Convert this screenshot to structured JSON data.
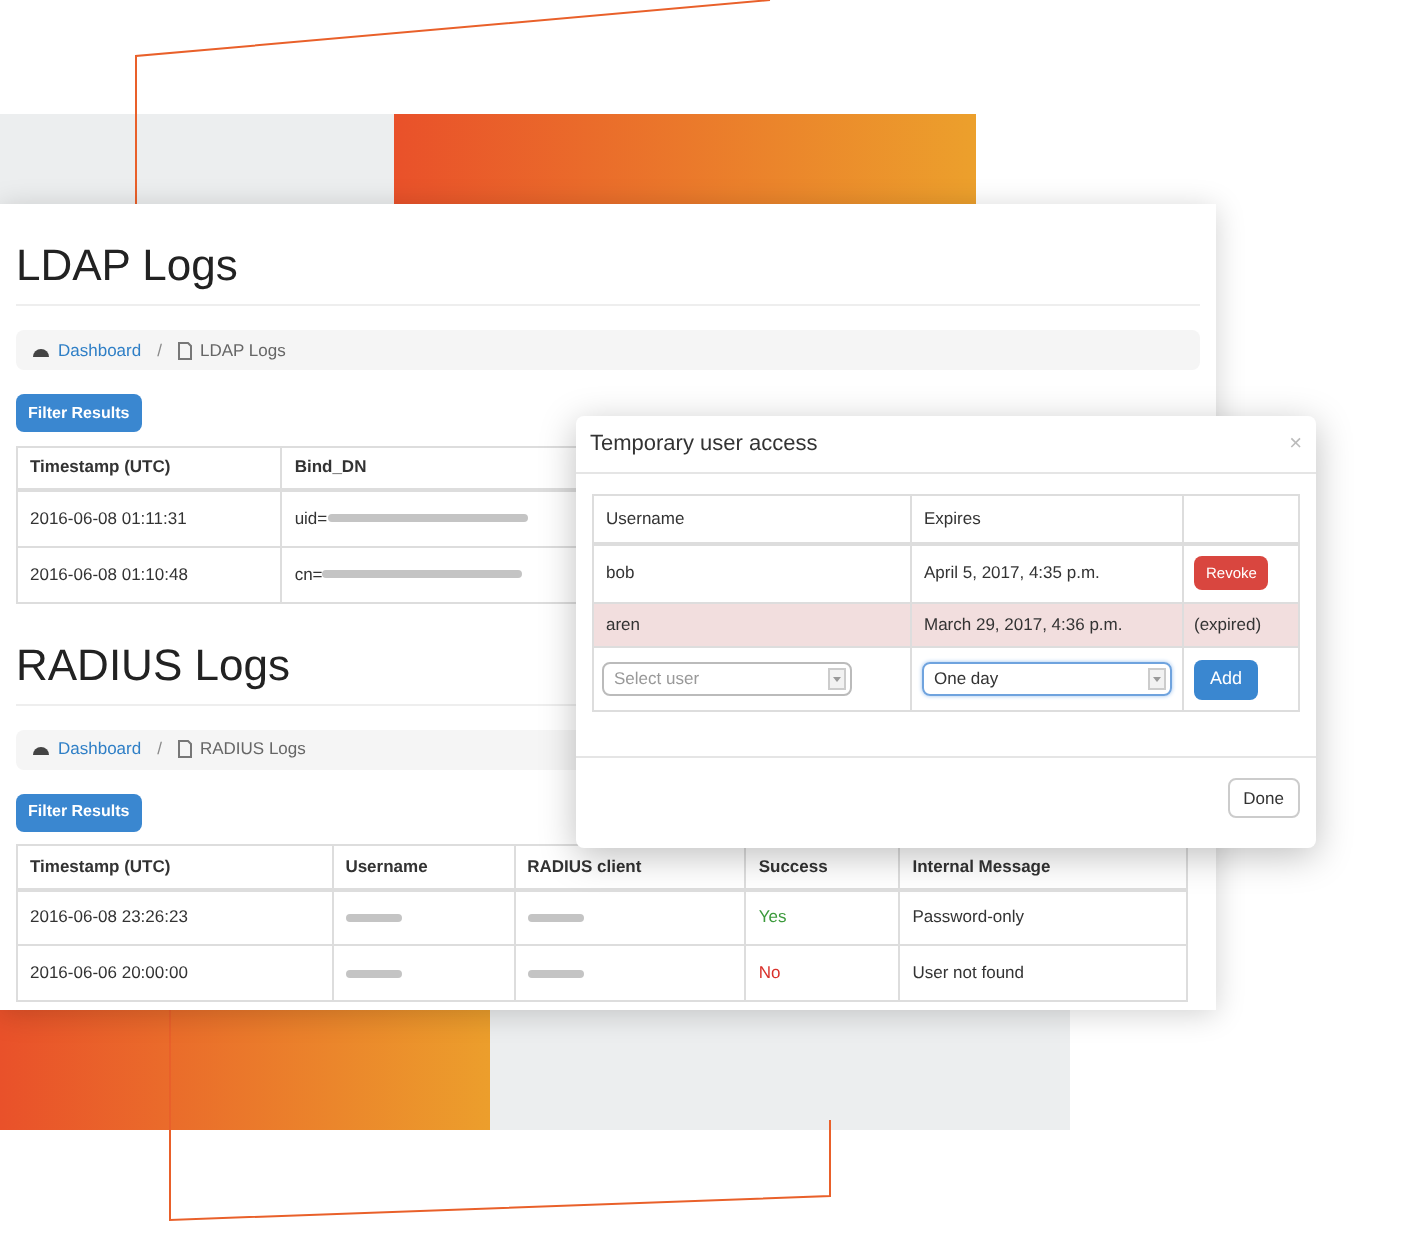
{
  "ldap": {
    "title": "LDAP Logs",
    "breadcrumb": {
      "home": "Dashboard",
      "separator": "/",
      "current": "LDAP Logs"
    },
    "filter_button": "Filter Results",
    "table": {
      "columns": [
        "Timestamp (UTC)",
        "Bind_DN"
      ],
      "rows": [
        {
          "cells": [
            {
              "kind": "text",
              "text": "2016-06-08 01:11:31"
            },
            {
              "kind": "partial",
              "text": "uid="
            }
          ]
        },
        {
          "cells": [
            {
              "kind": "text",
              "text": "2016-06-08 01:10:48"
            },
            {
              "kind": "partial",
              "text": "cn="
            }
          ]
        }
      ]
    }
  },
  "radius": {
    "title": "RADIUS Logs",
    "breadcrumb": {
      "home": "Dashboard",
      "separator": "/",
      "current": "RADIUS Logs"
    },
    "filter_button": "Filter Results",
    "table": {
      "columns": [
        "Timestamp (UTC)",
        "Username",
        "RADIUS client",
        "Success",
        "Internal Message"
      ],
      "rows": [
        {
          "cells": [
            {
              "kind": "text",
              "text": "2016-06-08 23:26:23"
            },
            {
              "kind": "redacted"
            },
            {
              "kind": "redacted"
            },
            {
              "kind": "status",
              "text": "Yes",
              "ok": true
            },
            {
              "kind": "text",
              "text": "Password-only"
            }
          ]
        },
        {
          "cells": [
            {
              "kind": "text",
              "text": "2016-06-06 20:00:00"
            },
            {
              "kind": "redacted"
            },
            {
              "kind": "redacted"
            },
            {
              "kind": "status",
              "text": "No",
              "ok": false
            },
            {
              "kind": "text",
              "text": "User not found"
            }
          ]
        }
      ]
    }
  },
  "modal": {
    "title": "Temporary user access",
    "close": "×",
    "columns": [
      "Username",
      "Expires"
    ],
    "rows": [
      {
        "username": "bob",
        "expires": "April 5, 2017, 4:35 p.m.",
        "kind": "active",
        "action": "Revoke"
      },
      {
        "username": "aren",
        "expires": "March 29, 2017, 4:36 p.m.",
        "kind": "expired",
        "action": "(expired)"
      }
    ],
    "form": {
      "user": {
        "placeholder": "Select user",
        "focused": false
      },
      "duration": {
        "value": "One day",
        "focused": true
      },
      "add": "Add"
    },
    "done": "Done"
  }
}
